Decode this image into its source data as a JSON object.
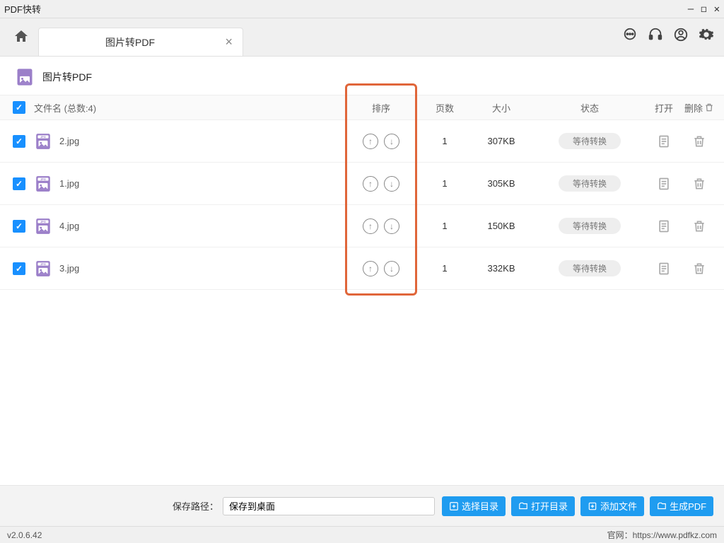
{
  "window": {
    "title": "PDF快转"
  },
  "tab": {
    "label": "图片转PDF"
  },
  "page": {
    "title": "图片转PDF"
  },
  "columns": {
    "filename": "文件名 (总数:4)",
    "sort": "排序",
    "pages": "页数",
    "size": "大小",
    "status": "状态",
    "open": "打开",
    "delete": "删除"
  },
  "rows": [
    {
      "name": "2.jpg",
      "pages": "1",
      "size": "307KB",
      "status": "等待转换"
    },
    {
      "name": "1.jpg",
      "pages": "1",
      "size": "305KB",
      "status": "等待转换"
    },
    {
      "name": "4.jpg",
      "pages": "1",
      "size": "150KB",
      "status": "等待转换"
    },
    {
      "name": "3.jpg",
      "pages": "1",
      "size": "332KB",
      "status": "等待转换"
    }
  ],
  "footer": {
    "path_label": "保存路径：",
    "path_value": "保存到桌面",
    "choose_dir": "选择目录",
    "open_dir": "打开目录",
    "add_file": "添加文件",
    "generate": "生成PDF"
  },
  "status": {
    "version": "v2.0.6.42",
    "site_label": "官网：",
    "site_url": "https://www.pdfkz.com"
  }
}
